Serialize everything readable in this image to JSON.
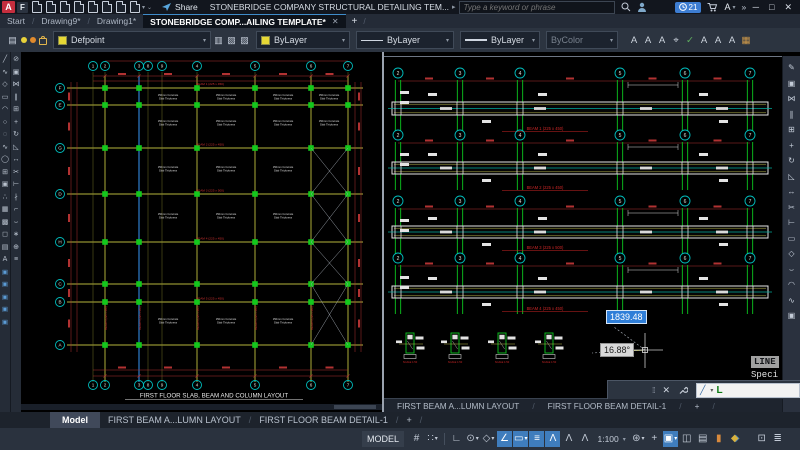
{
  "titlebar": {
    "logo_letter": "A",
    "menu_letter": "F",
    "qat_icons": [
      "new-drawing",
      "open-drawing",
      "save-drawing",
      "save-as",
      "plot",
      "undo",
      "redo",
      "batch-plot"
    ],
    "share_label": "Share",
    "document_title": "STONEBRIDGE COMPANY STRUCTURAL DETAILING TEM...",
    "search_placeholder": "Type a keyword or phrase",
    "notification_count": "21"
  },
  "file_tabs": {
    "tabs": [
      "Start",
      "Drawing9*",
      "Drawing1*"
    ],
    "active_tab": "STONEBRIDGE COMP...AILING TEMPLATE*",
    "new_tab_label": "+"
  },
  "properties_bar": {
    "layer_value": "Defpoint",
    "color_value": "ByLayer",
    "linetype_value": "ByLayer",
    "lineweight_value": "ByLayer",
    "plot_style_value": "ByColor",
    "text_tool_icons": [
      "text-style",
      "single-line-text",
      "edit-text",
      "find-text",
      "spell-check",
      "text-align",
      "text-mask",
      "text-frame",
      "table"
    ]
  },
  "draw_toolbar_icons": [
    "line",
    "polyline",
    "polygon",
    "rectangle",
    "arc",
    "circle",
    "revision-cloud",
    "spline",
    "ellipse",
    "insert-block",
    "create-block",
    "point",
    "hatch",
    "gradient",
    "region",
    "table",
    "multiline-text"
  ],
  "modify_toolbar_icons": [
    "erase",
    "copy",
    "mirror",
    "offset",
    "array",
    "move",
    "rotate",
    "scale",
    "stretch",
    "trim",
    "extend",
    "break",
    "chamfer",
    "fillet",
    "explode",
    "join",
    "align"
  ],
  "layer_tool_icons": [
    "layer-match",
    "layer-isolate",
    "layer-freeze",
    "layer-off",
    "layer-lock"
  ],
  "right_toolbar_icons": [
    "edit",
    "copy",
    "mirror",
    "offset",
    "array",
    "move",
    "rotate",
    "scale",
    "stretch",
    "trim",
    "extend",
    "rectangle",
    "polygon",
    "fillet",
    "arc",
    "spline",
    "group"
  ],
  "floor_plan": {
    "title": "FIRST FLOOR SLAB, BEAM AND COLUMN LAYOUT",
    "column_bubbles": [
      "1",
      "2",
      "3",
      "8",
      "9",
      "4",
      "5",
      "6",
      "7"
    ],
    "row_bubbles": [
      "F",
      "E",
      "G",
      "D",
      "H",
      "C",
      "B",
      "A"
    ],
    "slab_label_line1": "150mm Concrete",
    "slab_label_line2": "Slab Thickness",
    "beam_labels": [
      "BEAM 1 (225 x 450)",
      "BEAM 2 (225 x 450)",
      "BEAM 3 (225 x 500)",
      "BEAM 4 (225 x 450)",
      "BEAM 5 (225 x 450)"
    ]
  },
  "beam_details": {
    "grid_bubbles": [
      "2",
      "3",
      "4",
      "5",
      "6",
      "7"
    ],
    "strips": [
      {
        "label": "BEAM 1 (225 x 450)"
      },
      {
        "label": "BEAM 2 (225 x 450)"
      },
      {
        "label": "BEAM 3 (225 x 500)"
      },
      {
        "label": "BEAM 4 (225 x 450)"
      }
    ],
    "sections": [
      {
        "label": "SCALE 1:50"
      },
      {
        "label": "SCALE 1:50"
      },
      {
        "label": "SCALE 1:50"
      },
      {
        "label": "SCALE 1:50"
      }
    ],
    "layout_tabs": [
      "FIRST BEAM A...LUMN LAYOUT",
      "FIRST FLOOR BEAM DETAIL-1"
    ],
    "new_tab_label": "+"
  },
  "dynamic_input": {
    "distance": "1839.48",
    "angle": "16.88°",
    "prompt": "Specify next point or"
  },
  "command_line": {
    "history_command": "LINE",
    "history_text": "Speci",
    "input_text": "L"
  },
  "layout_bar": {
    "model_tab": "Model",
    "layout_tabs": [
      "FIRST BEAM A...LUMN LAYOUT",
      "FIRST FLOOR BEAM DETAIL-1"
    ],
    "new_tab_label": "+"
  },
  "status_bar": {
    "model_button": "MODEL",
    "annotation_scale": "1:100",
    "items": [
      {
        "name": "grid-display-icon",
        "key": "grid"
      },
      {
        "name": "snap-mode-icon",
        "key": "snap",
        "caret": true
      },
      {
        "name": "separator",
        "sep": true
      },
      {
        "name": "ortho-mode-icon",
        "key": "ortho"
      },
      {
        "name": "polar-tracking-icon",
        "key": "polar",
        "caret": true
      },
      {
        "name": "isometric-drafting-icon",
        "key": "iso",
        "caret": true
      },
      {
        "name": "object-snap-tracking-icon",
        "key": "otrack",
        "active": true
      },
      {
        "name": "dynamic-input-icon",
        "key": "dyn",
        "active": true,
        "caret": true
      },
      {
        "name": "lineweight-display-icon",
        "key": "lwt",
        "active": true
      },
      {
        "name": "annotation-visibility-icon",
        "key": "annvis",
        "active": true
      },
      {
        "name": "annotation-autoscale-icon",
        "key": "autoscale"
      },
      {
        "name": "annotation-scale-person-icon",
        "key": "annperson"
      },
      {
        "name": "annotation-scale-value",
        "scale": true,
        "caret": true
      },
      {
        "name": "workspace-switching-icon",
        "key": "workspace",
        "caret": true
      },
      {
        "name": "annotation-monitor-icon",
        "key": "annmon"
      },
      {
        "name": "hardware-acceleration-icon",
        "key": "hw",
        "active": true,
        "caret": true
      },
      {
        "name": "quick-properties-icon",
        "key": "qp"
      },
      {
        "name": "plot-icon",
        "key": "plot"
      },
      {
        "name": "performance-icon",
        "key": "perf",
        "cls": "ic-perf"
      },
      {
        "name": "graphics-shield-icon",
        "key": "shield",
        "cls": "ic-shield"
      },
      {
        "name": "gap",
        "gap": true
      },
      {
        "name": "clean-screen-icon",
        "key": "clean"
      },
      {
        "name": "customize-icon",
        "key": "customize"
      }
    ]
  }
}
